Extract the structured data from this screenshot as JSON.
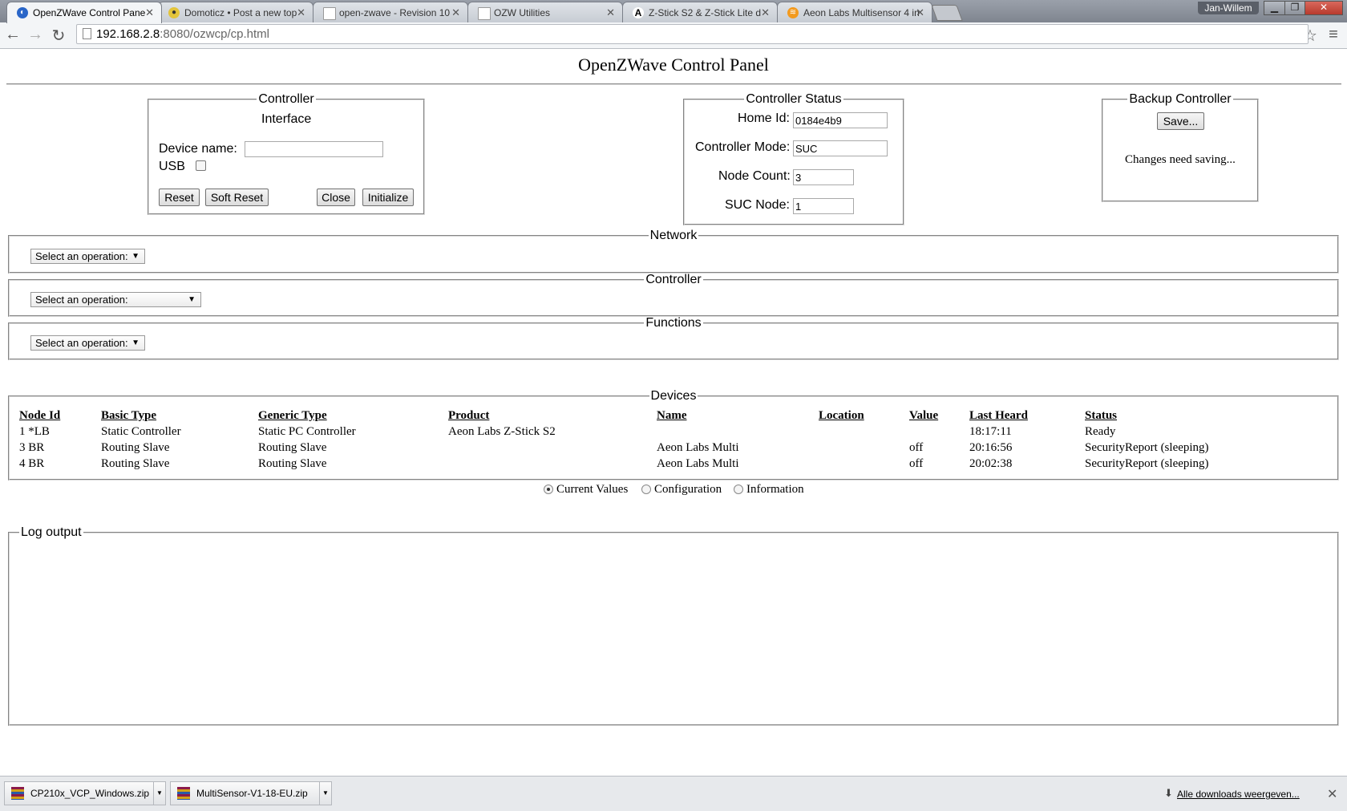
{
  "browser": {
    "tabs": [
      {
        "title": "OpenZWave Control Pane",
        "active": true
      },
      {
        "title": "Domoticz • Post a new top",
        "active": false
      },
      {
        "title": "open-zwave - Revision 10",
        "active": false
      },
      {
        "title": "OZW Utilities",
        "active": false
      },
      {
        "title": "Z-Stick S2 & Z-Stick Lite d",
        "active": false
      },
      {
        "title": "Aeon Labs Multisensor 4 in",
        "active": false
      }
    ],
    "profile_name": "Jan-Willem",
    "url_host": "192.168.2.8",
    "url_rest": ":8080/ozwcp/cp.html"
  },
  "page": {
    "title": "OpenZWave Control Panel"
  },
  "controller_box": {
    "legend": "Controller",
    "subtitle": "Interface",
    "device_name_label": "Device name:",
    "device_name_value": "",
    "usb_label": "USB",
    "reset_label": "Reset",
    "soft_reset_label": "Soft Reset",
    "close_label": "Close",
    "initialize_label": "Initialize"
  },
  "status_box": {
    "legend": "Controller Status",
    "home_id_label": "Home Id:",
    "home_id_value": "0184e4b9",
    "mode_label": "Controller Mode:",
    "mode_value": "SUC",
    "node_count_label": "Node Count:",
    "node_count_value": "3",
    "suc_node_label": "SUC Node:",
    "suc_node_value": "1"
  },
  "backup_box": {
    "legend": "Backup Controller",
    "save_label": "Save...",
    "message": "Changes need saving..."
  },
  "network": {
    "legend": "Network",
    "select_value": "Select an operation:"
  },
  "controller_ops": {
    "legend": "Controller",
    "select_value": "Select an operation:"
  },
  "functions": {
    "legend": "Functions",
    "select_value": "Select an operation:"
  },
  "devices": {
    "legend": "Devices",
    "columns": [
      "Node Id",
      "Basic Type",
      "Generic Type",
      "Product",
      "Name",
      "Location",
      "Value",
      "Last Heard",
      "Status"
    ],
    "rows": [
      [
        "1 *LB",
        "Static Controller",
        "Static PC Controller",
        "Aeon Labs Z-Stick S2",
        "",
        "",
        "",
        "18:17:11",
        "Ready"
      ],
      [
        "3 BR",
        "Routing Slave",
        "Routing Slave",
        "",
        "Aeon Labs Multi",
        "",
        "off",
        "20:16:56",
        "SecurityReport (sleeping)"
      ],
      [
        "4 BR",
        "Routing Slave",
        "Routing Slave",
        "",
        "Aeon Labs Multi",
        "",
        "off",
        "20:02:38",
        "SecurityReport (sleeping)"
      ]
    ]
  },
  "view_options": {
    "current_values": "Current Values",
    "configuration": "Configuration",
    "information": "Information",
    "selected": "current_values"
  },
  "log": {
    "legend": "Log output"
  },
  "downloads": {
    "items": [
      "CP210x_VCP_Windows.zip",
      "MultiSensor-V1-18-EU.zip"
    ],
    "show_all": "Alle downloads weergeven..."
  }
}
